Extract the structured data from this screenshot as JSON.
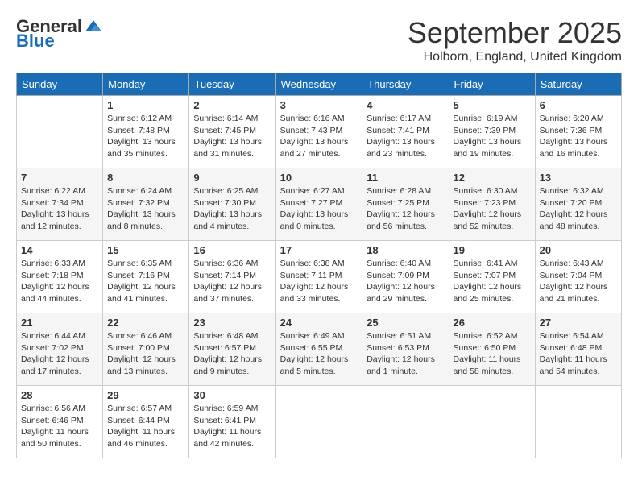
{
  "logo": {
    "general": "General",
    "blue": "Blue"
  },
  "title": "September 2025",
  "location": "Holborn, England, United Kingdom",
  "days_of_week": [
    "Sunday",
    "Monday",
    "Tuesday",
    "Wednesday",
    "Thursday",
    "Friday",
    "Saturday"
  ],
  "weeks": [
    [
      {
        "day": "",
        "info": ""
      },
      {
        "day": "1",
        "info": "Sunrise: 6:12 AM\nSunset: 7:48 PM\nDaylight: 13 hours\nand 35 minutes."
      },
      {
        "day": "2",
        "info": "Sunrise: 6:14 AM\nSunset: 7:45 PM\nDaylight: 13 hours\nand 31 minutes."
      },
      {
        "day": "3",
        "info": "Sunrise: 6:16 AM\nSunset: 7:43 PM\nDaylight: 13 hours\nand 27 minutes."
      },
      {
        "day": "4",
        "info": "Sunrise: 6:17 AM\nSunset: 7:41 PM\nDaylight: 13 hours\nand 23 minutes."
      },
      {
        "day": "5",
        "info": "Sunrise: 6:19 AM\nSunset: 7:39 PM\nDaylight: 13 hours\nand 19 minutes."
      },
      {
        "day": "6",
        "info": "Sunrise: 6:20 AM\nSunset: 7:36 PM\nDaylight: 13 hours\nand 16 minutes."
      }
    ],
    [
      {
        "day": "7",
        "info": "Sunrise: 6:22 AM\nSunset: 7:34 PM\nDaylight: 13 hours\nand 12 minutes."
      },
      {
        "day": "8",
        "info": "Sunrise: 6:24 AM\nSunset: 7:32 PM\nDaylight: 13 hours\nand 8 minutes."
      },
      {
        "day": "9",
        "info": "Sunrise: 6:25 AM\nSunset: 7:30 PM\nDaylight: 13 hours\nand 4 minutes."
      },
      {
        "day": "10",
        "info": "Sunrise: 6:27 AM\nSunset: 7:27 PM\nDaylight: 13 hours\nand 0 minutes."
      },
      {
        "day": "11",
        "info": "Sunrise: 6:28 AM\nSunset: 7:25 PM\nDaylight: 12 hours\nand 56 minutes."
      },
      {
        "day": "12",
        "info": "Sunrise: 6:30 AM\nSunset: 7:23 PM\nDaylight: 12 hours\nand 52 minutes."
      },
      {
        "day": "13",
        "info": "Sunrise: 6:32 AM\nSunset: 7:20 PM\nDaylight: 12 hours\nand 48 minutes."
      }
    ],
    [
      {
        "day": "14",
        "info": "Sunrise: 6:33 AM\nSunset: 7:18 PM\nDaylight: 12 hours\nand 44 minutes."
      },
      {
        "day": "15",
        "info": "Sunrise: 6:35 AM\nSunset: 7:16 PM\nDaylight: 12 hours\nand 41 minutes."
      },
      {
        "day": "16",
        "info": "Sunrise: 6:36 AM\nSunset: 7:14 PM\nDaylight: 12 hours\nand 37 minutes."
      },
      {
        "day": "17",
        "info": "Sunrise: 6:38 AM\nSunset: 7:11 PM\nDaylight: 12 hours\nand 33 minutes."
      },
      {
        "day": "18",
        "info": "Sunrise: 6:40 AM\nSunset: 7:09 PM\nDaylight: 12 hours\nand 29 minutes."
      },
      {
        "day": "19",
        "info": "Sunrise: 6:41 AM\nSunset: 7:07 PM\nDaylight: 12 hours\nand 25 minutes."
      },
      {
        "day": "20",
        "info": "Sunrise: 6:43 AM\nSunset: 7:04 PM\nDaylight: 12 hours\nand 21 minutes."
      }
    ],
    [
      {
        "day": "21",
        "info": "Sunrise: 6:44 AM\nSunset: 7:02 PM\nDaylight: 12 hours\nand 17 minutes."
      },
      {
        "day": "22",
        "info": "Sunrise: 6:46 AM\nSunset: 7:00 PM\nDaylight: 12 hours\nand 13 minutes."
      },
      {
        "day": "23",
        "info": "Sunrise: 6:48 AM\nSunset: 6:57 PM\nDaylight: 12 hours\nand 9 minutes."
      },
      {
        "day": "24",
        "info": "Sunrise: 6:49 AM\nSunset: 6:55 PM\nDaylight: 12 hours\nand 5 minutes."
      },
      {
        "day": "25",
        "info": "Sunrise: 6:51 AM\nSunset: 6:53 PM\nDaylight: 12 hours\nand 1 minute."
      },
      {
        "day": "26",
        "info": "Sunrise: 6:52 AM\nSunset: 6:50 PM\nDaylight: 11 hours\nand 58 minutes."
      },
      {
        "day": "27",
        "info": "Sunrise: 6:54 AM\nSunset: 6:48 PM\nDaylight: 11 hours\nand 54 minutes."
      }
    ],
    [
      {
        "day": "28",
        "info": "Sunrise: 6:56 AM\nSunset: 6:46 PM\nDaylight: 11 hours\nand 50 minutes."
      },
      {
        "day": "29",
        "info": "Sunrise: 6:57 AM\nSunset: 6:44 PM\nDaylight: 11 hours\nand 46 minutes."
      },
      {
        "day": "30",
        "info": "Sunrise: 6:59 AM\nSunset: 6:41 PM\nDaylight: 11 hours\nand 42 minutes."
      },
      {
        "day": "",
        "info": ""
      },
      {
        "day": "",
        "info": ""
      },
      {
        "day": "",
        "info": ""
      },
      {
        "day": "",
        "info": ""
      }
    ]
  ]
}
